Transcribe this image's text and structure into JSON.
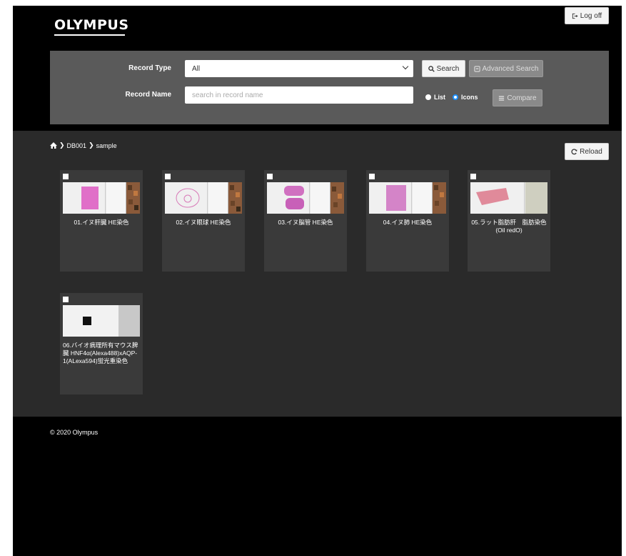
{
  "header": {
    "logo": "OLYMPUS",
    "logoff_label": "Log off"
  },
  "search": {
    "record_type_label": "Record Type",
    "record_type_value": "All",
    "record_name_label": "Record Name",
    "record_name_placeholder": "search in record name",
    "search_label": "Search",
    "advanced_label": "Advanced Search",
    "list_label": "List",
    "icons_label": "Icons",
    "compare_label": "Compare"
  },
  "breadcrumb": [
    "DB001",
    "sample"
  ],
  "reload_label": "Reload",
  "records": [
    {
      "caption": "01.イヌ肝臓 HE染色"
    },
    {
      "caption": "02.イヌ眼球 HE染色"
    },
    {
      "caption": "03.イヌ脳管 HE染色"
    },
    {
      "caption": "04.イヌ肺 HE染色"
    },
    {
      "caption": "05.ラット脂肪肝　脂肪染色 (Oil redO)"
    },
    {
      "caption": "06.バイオ病理所有マウス脾臓 HNF4α(Alexa488)xAQP-1(ALexa594)蛍光重染色"
    }
  ],
  "footer": {
    "copyright": "© 2020 Olympus"
  },
  "colors": {
    "background": "#000000",
    "panel": "#5a5a5a",
    "content": "#2a2a2a",
    "card": "#3a3a3a",
    "radio_selected": "#1e90ff"
  }
}
